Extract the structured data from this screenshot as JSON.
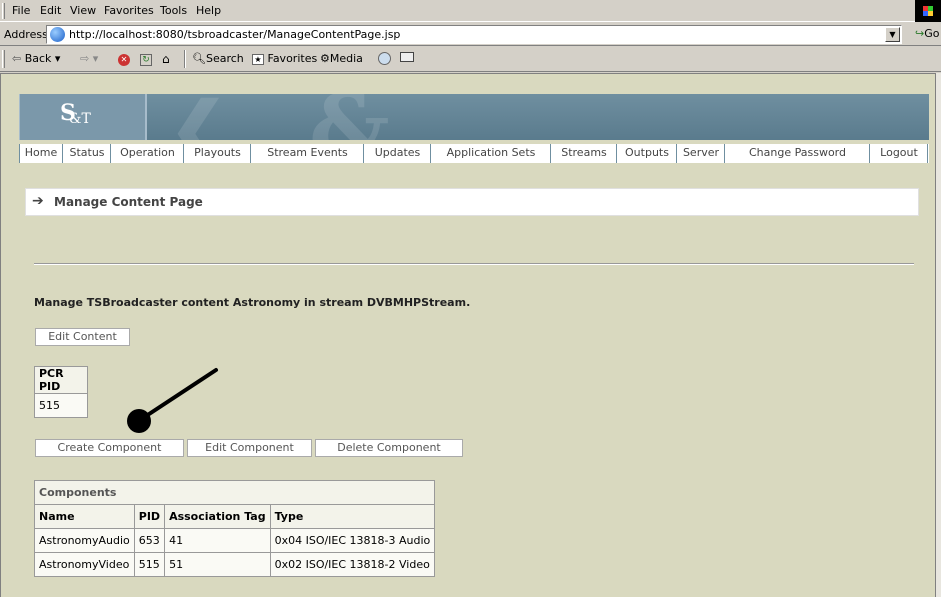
{
  "browser": {
    "menu": [
      "File",
      "Edit",
      "View",
      "Favorites",
      "Tools",
      "Help"
    ],
    "address_label": "Address",
    "url": "http://localhost:8080/tsbroadcaster/ManageContentPage.jsp",
    "go_label": "Go",
    "toolbar": {
      "back": "Back",
      "search": "Search",
      "favorites": "Favorites",
      "media": "Media"
    }
  },
  "nav": {
    "items": [
      "Home",
      "Status",
      "Operation",
      "Playouts",
      "Stream Events",
      "Updates",
      "Application Sets",
      "Streams",
      "Outputs",
      "Server",
      "Change Password",
      "Logout"
    ]
  },
  "page": {
    "title": "Manage Content Page",
    "description": "Manage TSBroadcaster content Astronomy in stream DVBMHPStream.",
    "edit_content_button": "Edit Content",
    "pcr": {
      "header": "PCR PID",
      "value": "515"
    },
    "component_buttons": [
      "Create Component",
      "Edit Component",
      "Delete Component"
    ],
    "components": {
      "caption": "Components",
      "columns": [
        "Name",
        "PID",
        "Association Tag",
        "Type"
      ],
      "rows": [
        [
          "AstronomyAudio",
          "653",
          "41",
          "0x04 ISO/IEC 13818-3 Audio"
        ],
        [
          "AstronomyVideo",
          "515",
          "51",
          "0x02 ISO/IEC 13818-2 Video"
        ]
      ]
    }
  },
  "colors": {
    "page_bg": "#d9d9bf",
    "banner": "#6f8fa0",
    "chrome": "#d4d0c8"
  }
}
